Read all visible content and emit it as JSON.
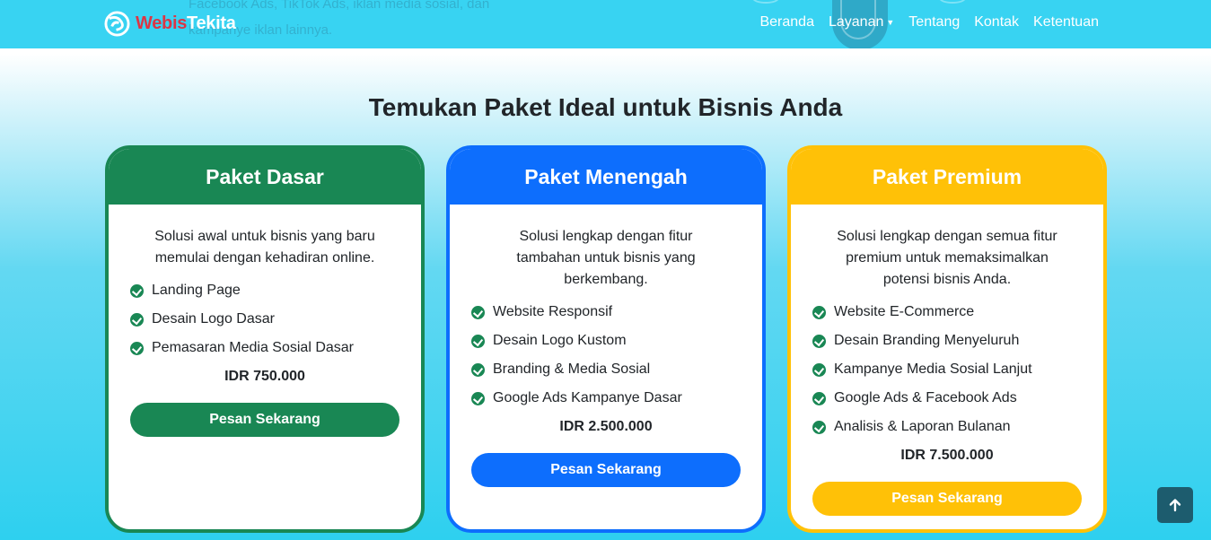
{
  "navbar": {
    "brand_part1": "Webis",
    "brand_part2": "Tekita",
    "ghost_text": "Facebook Ads, TikTok Ads, iklan media sosial, dan kampanye iklan lainnya.",
    "links": [
      {
        "label": "Beranda"
      },
      {
        "label": "Layanan"
      },
      {
        "label": "Tentang"
      },
      {
        "label": "Kontak"
      },
      {
        "label": "Ketentuan"
      }
    ],
    "logo_icon": "brand-logo-icon"
  },
  "section": {
    "title": "Temukan Paket Ideal untuk Bisnis Anda"
  },
  "packages": [
    {
      "name": "Paket Dasar",
      "color": "#198754",
      "description": "Solusi awal untuk bisnis yang baru memulai dengan kehadiran online.",
      "features": [
        "Landing Page",
        "Desain Logo Dasar",
        "Pemasaran Media Sosial Dasar"
      ],
      "price": "IDR 750.000",
      "button": "Pesan Sekarang"
    },
    {
      "name": "Paket Menengah",
      "color": "#0d6efd",
      "description": "Solusi lengkap dengan fitur tambahan untuk bisnis yang berkembang.",
      "features": [
        "Website Responsif",
        "Desain Logo Kustom",
        "Branding & Media Sosial",
        "Google Ads Kampanye Dasar"
      ],
      "price": "IDR 2.500.000",
      "button": "Pesan Sekarang"
    },
    {
      "name": "Paket Premium",
      "color": "#ffc107",
      "description": "Solusi lengkap dengan semua fitur premium untuk memaksimalkan potensi bisnis Anda.",
      "features": [
        "Website E-Commerce",
        "Desain Branding Menyeluruh",
        "Kampanye Media Sosial Lanjut",
        "Google Ads & Facebook Ads",
        "Analisis & Laporan Bulanan"
      ],
      "price": "IDR 7.500.000",
      "button": "Pesan Sekarang"
    }
  ],
  "back_to_top": {
    "icon": "arrow-up-icon"
  }
}
